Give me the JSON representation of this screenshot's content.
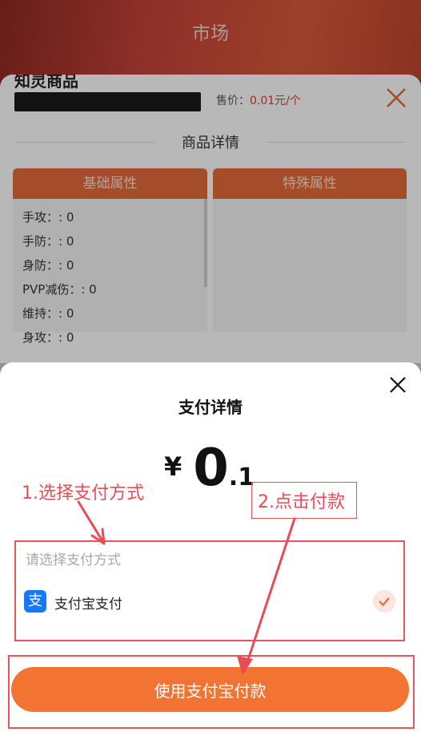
{
  "header": {
    "title": "市场"
  },
  "goods": {
    "name": "知灵商品",
    "price_label": "售价：",
    "price_value": "0.01元/个",
    "section_title": "商品详情",
    "tabs": [
      {
        "label": "基础属性"
      },
      {
        "label": "特殊属性"
      }
    ],
    "basic_attributes": [
      "手攻：: 0",
      "手防：: 0",
      "身防：: 0",
      "PVP减伤：: 0",
      "维持：: 0",
      "身攻：: 0"
    ]
  },
  "payment": {
    "title": "支付详情",
    "currency": "¥",
    "amount_int": "0",
    "amount_dec": ".1",
    "method_hint": "请选择支付方式",
    "method_icon_char": "支",
    "method_label": "支付宝支付",
    "pay_button": "使用支付宝付款"
  },
  "annotations": {
    "step1": "1.选择支付方式",
    "step2": "2.点击付款"
  },
  "colors": {
    "accent": "#f37332",
    "tab": "#e56a3a",
    "annotation": "#ea4c55",
    "alipay": "#1678ff"
  }
}
